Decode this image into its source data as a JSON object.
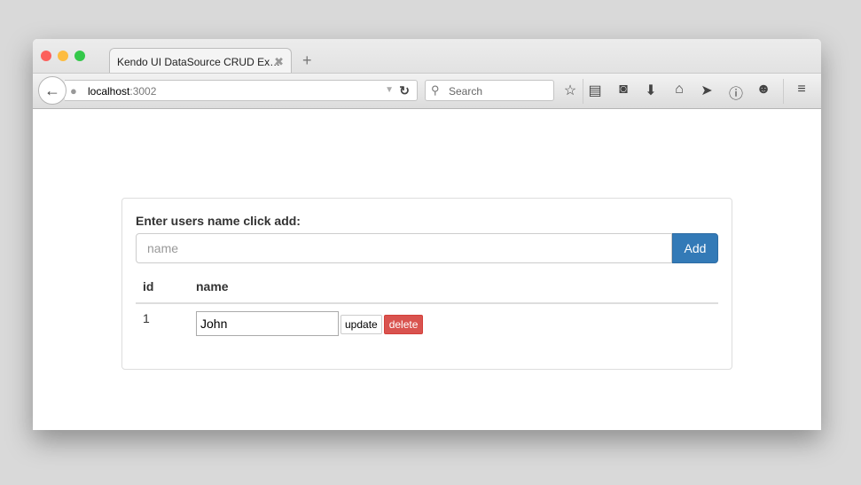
{
  "browser": {
    "tab_title": "Kendo UI DataSource CRUD Ex…",
    "url_host": "localhost",
    "url_port": ":3002",
    "search_placeholder": "Search"
  },
  "form": {
    "label": "Enter users name click add:",
    "input_placeholder": "name",
    "add_label": "Add"
  },
  "table": {
    "headers": [
      "id",
      "name"
    ],
    "rows": [
      {
        "id": "1",
        "name": "John"
      }
    ],
    "update_label": "update",
    "delete_label": "delete"
  }
}
